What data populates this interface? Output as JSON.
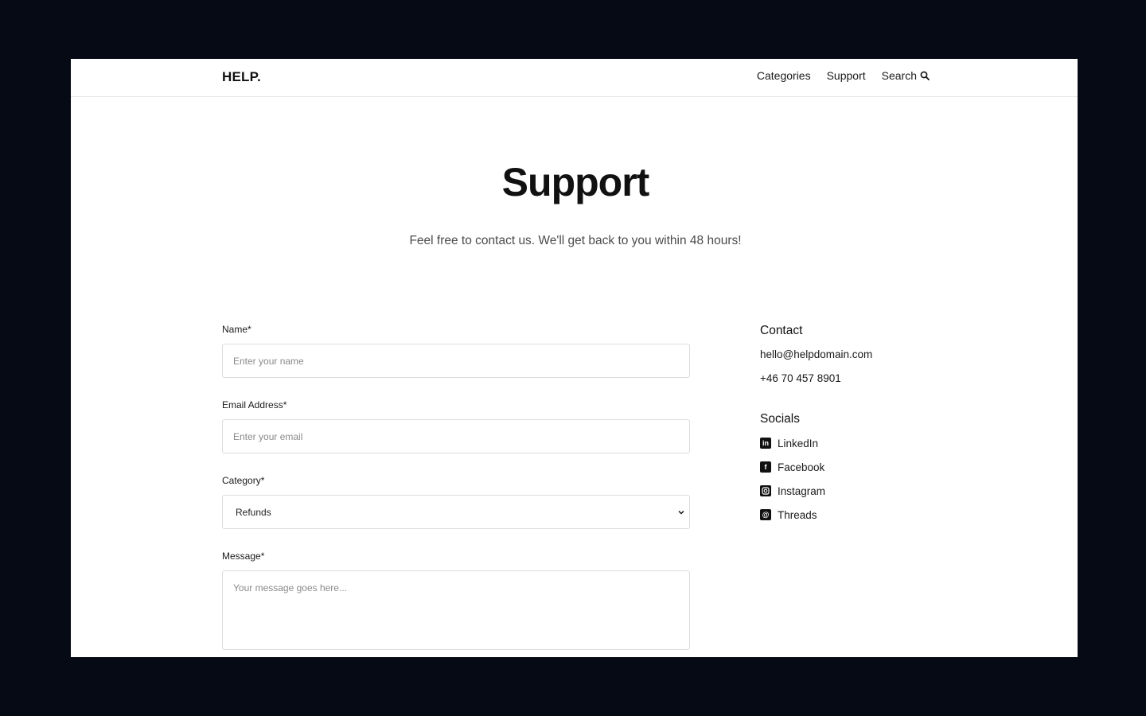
{
  "header": {
    "logo": "HELP.",
    "nav": [
      {
        "label": "Categories"
      },
      {
        "label": "Support"
      },
      {
        "label": "Search"
      }
    ]
  },
  "hero": {
    "title": "Support",
    "subtitle": "Feel free to contact us. We'll get back to you within 48 hours!"
  },
  "form": {
    "name": {
      "label": "Name*",
      "placeholder": "Enter your name"
    },
    "email": {
      "label": "Email Address*",
      "placeholder": "Enter your email"
    },
    "category": {
      "label": "Category*",
      "value": "Refunds"
    },
    "message": {
      "label": "Message*",
      "placeholder": "Your message goes here..."
    }
  },
  "contact": {
    "heading": "Contact",
    "email": "hello@helpdomain.com",
    "phone": "+46 70 457 8901"
  },
  "socials": {
    "heading": "Socials",
    "items": [
      {
        "label": "LinkedIn",
        "icon": "linkedin-icon"
      },
      {
        "label": "Facebook",
        "icon": "facebook-icon"
      },
      {
        "label": "Instagram",
        "icon": "instagram-icon"
      },
      {
        "label": "Threads",
        "icon": "threads-icon"
      }
    ]
  },
  "colors": {
    "backdrop": "#060a14",
    "page": "#ffffff",
    "text": "#111111",
    "border": "#dcdcdc"
  }
}
